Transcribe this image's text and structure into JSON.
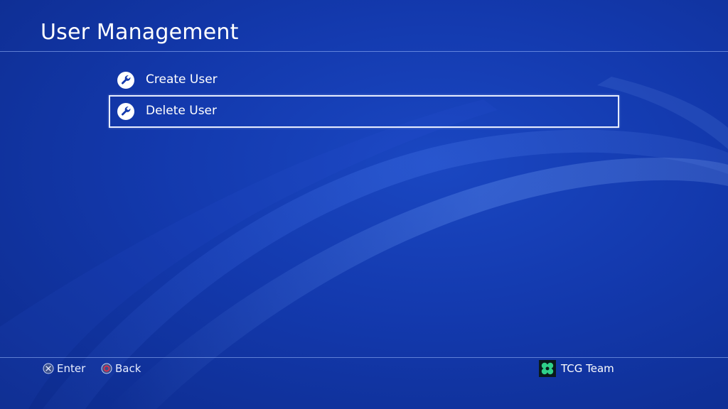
{
  "header": {
    "title": "User Management"
  },
  "menu": {
    "items": [
      {
        "label": "Create User",
        "icon": "wrench-icon",
        "selected": false
      },
      {
        "label": "Delete User",
        "icon": "wrench-icon",
        "selected": true
      }
    ]
  },
  "footer": {
    "enter": {
      "label": "Enter",
      "icon": "cross-button-icon"
    },
    "back": {
      "label": "Back",
      "icon": "circle-button-icon"
    },
    "profile": {
      "name": "TCG Team",
      "avatar_icon": "clover-avatar-icon"
    }
  },
  "colors": {
    "background": "#1339ad",
    "text": "#ffffff",
    "selection_border": "#e6ecff",
    "circle_button": "#c8102e",
    "avatar_green": "#2fd08a"
  }
}
